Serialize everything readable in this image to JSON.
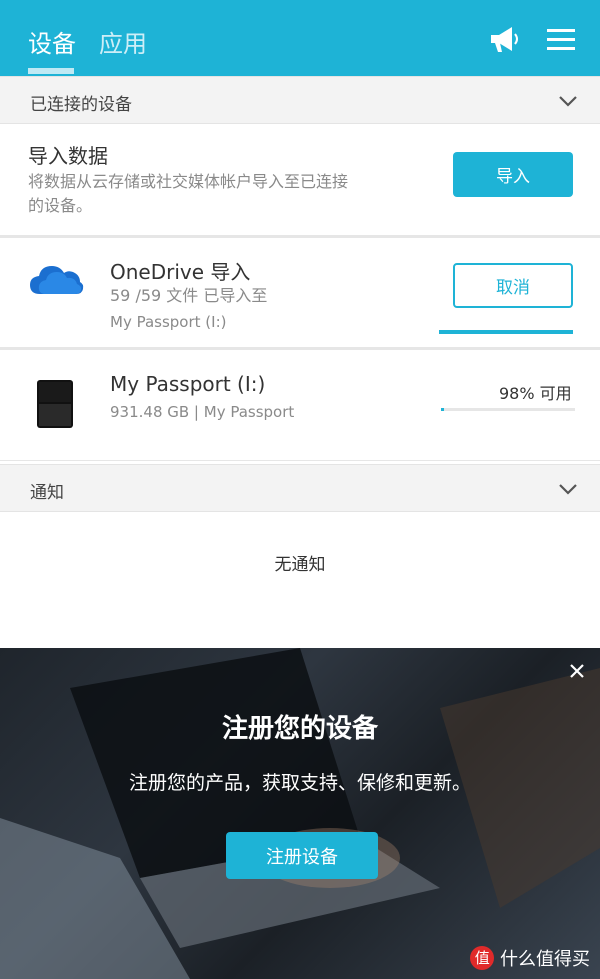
{
  "header": {
    "tabs": [
      {
        "label": "设备",
        "active": true
      },
      {
        "label": "应用",
        "active": false
      }
    ],
    "icons": [
      "megaphone-icon",
      "menu-icon"
    ],
    "accent_color": "#1eb3d6"
  },
  "connected_devices": {
    "section_label": "已连接的设备",
    "import_data": {
      "title": "导入数据",
      "description_line1": "将数据从云存储或社交媒体帐户导入至已连接",
      "description_line2": "的设备。",
      "button_label": "导入"
    },
    "onedrive": {
      "title": "OneDrive 导入",
      "status": "59 /59 文件 已导入至",
      "destination": "My Passport (I:)",
      "button_label": "取消",
      "progress": 1.0
    },
    "drive": {
      "title": "My Passport (I:)",
      "details": "931.48 GB | My Passport",
      "available_label": "98% 可用",
      "used_fraction": 0.02
    }
  },
  "notifications": {
    "section_label": "通知",
    "empty_text": "无通知"
  },
  "banner": {
    "title": "注册您的设备",
    "subtitle": "注册您的产品，获取支持、保修和更新。",
    "button_label": "注册设备"
  },
  "watermark": {
    "badge": "值",
    "text": "什么值得买"
  }
}
